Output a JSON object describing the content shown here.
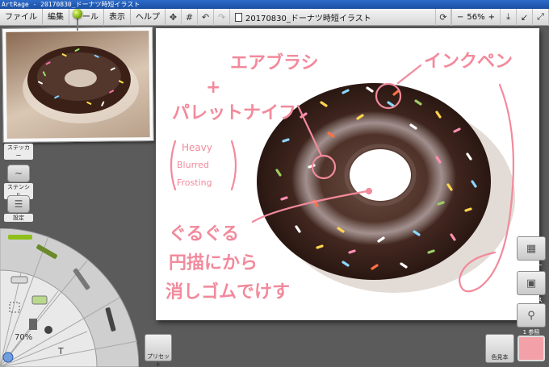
{
  "window": {
    "title": "ArtRage - 20170830_ドーナツ時短イラスト"
  },
  "menu": [
    "ファイル",
    "編集",
    "ツール",
    "表示",
    "ヘルプ"
  ],
  "toolbar": {
    "icons": [
      "move-icon",
      "grid-icon",
      "undo-icon",
      "redo-icon"
    ],
    "document_title": "20170830_ドーナツ時短イラスト",
    "zoom_minus": "−",
    "zoom_level": "56%",
    "zoom_plus": "+"
  },
  "left_tools": {
    "stickers": "ステッカー",
    "stencils": "ステンシル",
    "settings": "設定"
  },
  "tool_wheel": {
    "zoom": "70%",
    "text_tool": "T"
  },
  "right_panels": {
    "layers": "レイヤー",
    "tracing": "トレース",
    "reference_count": "1",
    "reference": "参照"
  },
  "bottom": {
    "presets": "プリセット",
    "swatches": "色見本"
  },
  "canvas_annotations": {
    "airbrush": "エアブラシ",
    "plus": "+",
    "palette_knife": "パレットナイフ",
    "heavy": "Heavy",
    "blurred": "Blurred",
    "frosting": "Frosting",
    "ink_pen": "インクペン",
    "line1": "ぐるぐる",
    "line2": "円描にから",
    "line3": "消しゴムでけす"
  },
  "colors": {
    "accent_pink": "#f28a9c",
    "chocolate": "#3a221b",
    "current_color": "#f4a0a8",
    "pin": "#8fbf1a"
  }
}
